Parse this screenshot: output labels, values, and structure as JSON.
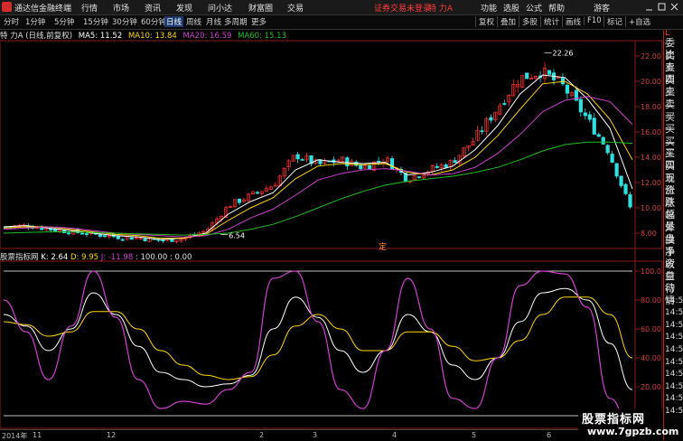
{
  "menubar": {
    "app_title": "通达信金融终端",
    "menus": [
      "行情",
      "市场",
      "资讯",
      "发现",
      "问小达",
      "财富圈",
      "交易"
    ],
    "warning": "证券交易未登录",
    "stock_name": "特 力A",
    "right_items": [
      "功能",
      "选股",
      "公式",
      "帮助",
      "游客"
    ]
  },
  "toolbar": {
    "periods": [
      "分时",
      "1分钟",
      "5分钟",
      "15分钟",
      "30分钟",
      "60分钟",
      "日线",
      "周线",
      "月线",
      "多周期",
      "更多"
    ],
    "active_period": "日线",
    "right_buttons": [
      "复权",
      "叠加",
      "多股",
      "统计",
      "画线",
      "F10",
      "标记",
      "+自选"
    ]
  },
  "legend": {
    "title": "特 力A (日线,前复权)",
    "ma5": "MA5: 11.52",
    "ma10": "MA10: 13.84",
    "ma20": "MA20: 16.59",
    "ma60": "MA60: 15.13"
  },
  "price_chart": {
    "high_label": "22.26",
    "low_label": "6.54",
    "marker": "定",
    "y_ticks": [
      "22.00",
      "20.00",
      "18.00",
      "16.00",
      "14.00",
      "12.00",
      "10.00",
      "8.00"
    ]
  },
  "oscillator": {
    "name": "股票指标网",
    "k": "K: 2.64",
    "d": "D: 9.95",
    "j": "J: -11.98",
    "levels": ": 100.00 : 0.00",
    "y_ticks": [
      "100.0",
      "80.00",
      "60.00",
      "40.00",
      "20.00"
    ]
  },
  "right_panel": {
    "top_tag": "L",
    "labels": [
      "委比",
      "卖五",
      "卖四",
      "卖三",
      "卖二",
      "卖一",
      "买一",
      "买二",
      "买三",
      "买四",
      "买五",
      "现价",
      "涨跌",
      "涨幅",
      "总量",
      "外盘",
      "换手",
      "净资",
      "收益",
      "自动",
      "行情",
      "14:5",
      "14:5",
      "14:5",
      "14:5",
      "14:5",
      "14:5",
      "14:5",
      "14:5",
      "14:5",
      "14:5"
    ]
  },
  "date_axis": {
    "labels": [
      "2014年",
      "11",
      "12",
      "2",
      "3",
      "4",
      "5",
      "6"
    ]
  },
  "watermark": {
    "line1": "股票指标网",
    "line2": "www.7gpzb.com"
  },
  "colors": {
    "ma5": "#ffffff",
    "ma10": "#ffd700",
    "ma20": "#d040d0",
    "ma60": "#20c020",
    "up": "#ff3030",
    "down": "#30e0e0",
    "k_line": "#ffffff",
    "d_line": "#ffd700",
    "j_line": "#d040d0"
  },
  "chart_data": [
    {
      "type": "candlestick",
      "title": "",
      "ylim": [
        7.0,
        23.0
      ],
      "ma_series": [
        {
          "name": "MA5",
          "values": [
            8.5,
            8.6,
            8.4,
            8.2,
            8.0,
            7.8,
            7.7,
            7.5,
            7.6,
            8.0,
            9.5,
            10.5,
            11.2,
            13.0,
            13.8,
            13.6,
            13.5,
            13.6,
            12.6,
            12.8,
            13.3,
            14.6,
            16.5,
            19.0,
            20.5,
            20.3,
            18.6,
            16.3,
            11.5
          ]
        },
        {
          "name": "MA10",
          "values": [
            8.4,
            8.5,
            8.5,
            8.3,
            8.1,
            7.9,
            7.8,
            7.6,
            7.6,
            7.9,
            9.0,
            10.0,
            10.8,
            12.3,
            13.3,
            13.5,
            13.4,
            13.5,
            12.8,
            12.6,
            13.0,
            14.0,
            15.7,
            17.8,
            19.8,
            20.0,
            19.0,
            17.0,
            13.8
          ]
        },
        {
          "name": "MA20",
          "values": [
            8.3,
            8.4,
            8.5,
            8.4,
            8.2,
            8.0,
            7.9,
            7.8,
            7.7,
            7.8,
            8.3,
            9.2,
            9.9,
            11.0,
            12.2,
            12.7,
            13.0,
            13.1,
            12.9,
            12.6,
            12.7,
            13.2,
            14.3,
            15.8,
            17.6,
            18.5,
            18.8,
            18.4,
            16.6
          ]
        },
        {
          "name": "MA60",
          "values": [
            8.0,
            8.05,
            8.1,
            8.1,
            8.05,
            8.0,
            7.95,
            7.9,
            7.85,
            7.9,
            8.0,
            8.3,
            8.7,
            9.3,
            10.0,
            10.7,
            11.3,
            11.8,
            12.1,
            12.3,
            12.5,
            12.8,
            13.2,
            13.8,
            14.5,
            15.0,
            15.2,
            15.2,
            15.1
          ]
        }
      ],
      "candle_closes": [
        8.5,
        8.6,
        8.3,
        8.1,
        7.9,
        7.7,
        7.6,
        7.4,
        7.6,
        8.2,
        10.2,
        11.0,
        11.8,
        14.2,
        13.4,
        13.8,
        13.2,
        13.9,
        12.3,
        13.0,
        13.6,
        15.4,
        17.8,
        20.2,
        20.8,
        19.6,
        17.2,
        14.6,
        10.0
      ],
      "high": 22.26,
      "low": 6.54
    },
    {
      "type": "line",
      "title": "",
      "ylim": [
        0,
        100
      ],
      "series": [
        {
          "name": "K",
          "values": [
            70,
            62,
            45,
            60,
            85,
            70,
            48,
            30,
            25,
            20,
            22,
            28,
            60,
            82,
            68,
            45,
            30,
            45,
            70,
            58,
            35,
            25,
            40,
            65,
            85,
            88,
            80,
            50,
            18
          ]
        },
        {
          "name": "D",
          "values": [
            65,
            63,
            55,
            58,
            72,
            72,
            60,
            45,
            35,
            28,
            25,
            27,
            42,
            62,
            70,
            60,
            45,
            45,
            58,
            58,
            48,
            38,
            40,
            52,
            70,
            82,
            82,
            70,
            40
          ]
        },
        {
          "name": "J",
          "values": [
            80,
            58,
            25,
            62,
            100,
            68,
            25,
            5,
            10,
            8,
            18,
            30,
            95,
            100,
            65,
            18,
            5,
            45,
            95,
            60,
            12,
            5,
            40,
            90,
            100,
            98,
            75,
            12,
            -12
          ]
        }
      ]
    }
  ]
}
